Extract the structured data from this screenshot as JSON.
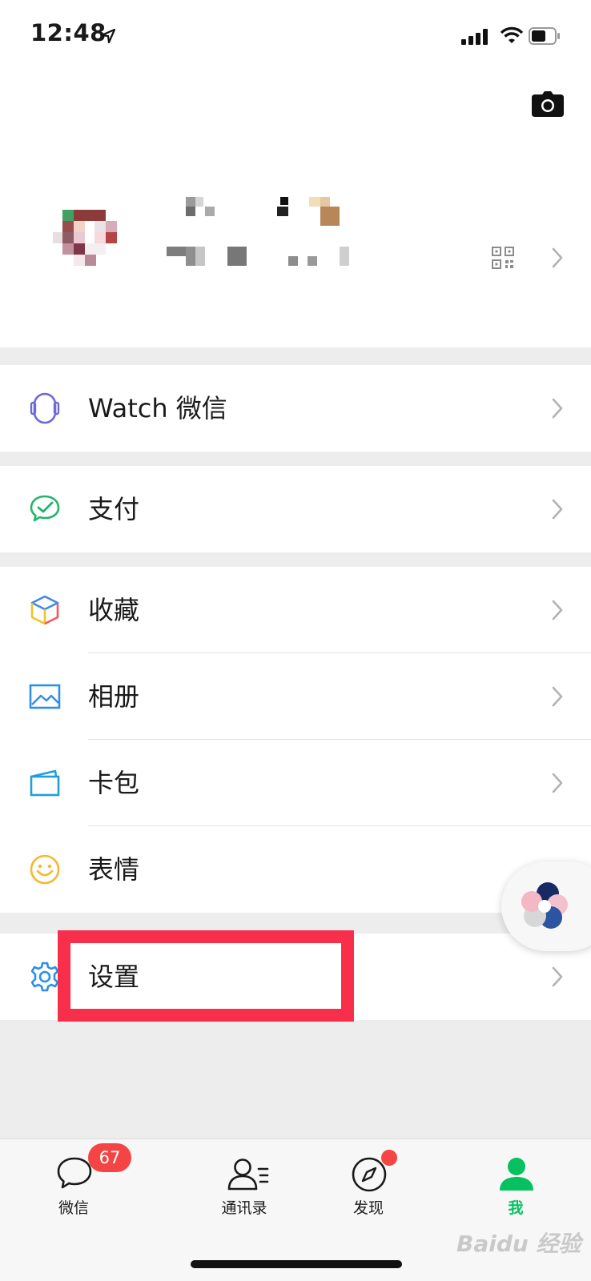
{
  "status_bar": {
    "time": "12:48"
  },
  "menu": {
    "watch": "Watch 微信",
    "pay": "支付",
    "favorites": "收藏",
    "album": "相册",
    "cards": "卡包",
    "stickers": "表情",
    "settings": "设置"
  },
  "tabs": {
    "chats": "微信",
    "contacts": "通讯录",
    "discover": "发现",
    "me": "我",
    "chats_badge": "67"
  },
  "colors": {
    "accent_green": "#07c160",
    "badge_red": "#f44444",
    "highlight_red": "#f72f4b"
  },
  "watermark": "Baidu 经验"
}
